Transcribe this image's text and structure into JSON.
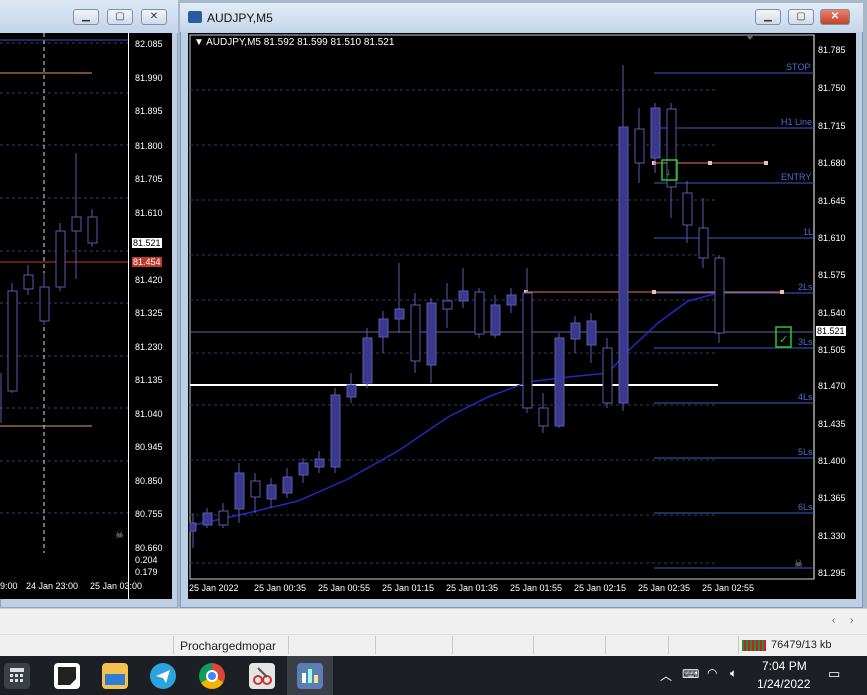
{
  "left_window": {
    "price_labels": [
      "82.085",
      "81.990",
      "81.895",
      "81.800",
      "81.705",
      "81.610",
      "81.521",
      "81.454",
      "81.420",
      "81.325",
      "81.230",
      "81.135",
      "81.040",
      "80.945",
      "80.850",
      "80.755",
      "80.660",
      "0.204",
      "0.179"
    ],
    "time_labels": [
      "9:00",
      "24 Jan 23:00",
      "25 Jan 03:00"
    ]
  },
  "right_window": {
    "title": "AUDJPY,M5",
    "chart_header": "▼ AUDJPY,M5  81.592 81.599 81.510 81.521",
    "price_labels": [
      "81.785",
      "81.750",
      "81.715",
      "81.680",
      "81.645",
      "81.610",
      "81.575",
      "81.540",
      "81.521",
      "81.505",
      "81.470",
      "81.435",
      "81.400",
      "81.365",
      "81.330",
      "81.295"
    ],
    "time_labels": [
      "25 Jan 2022",
      "25 Jan 00:35",
      "25 Jan 00:55",
      "25 Jan 01:15",
      "25 Jan 01:35",
      "25 Jan 01:55",
      "25 Jan 02:15",
      "25 Jan 02:35",
      "25 Jan 02:55"
    ],
    "level_labels": [
      "STOP",
      "H1 Line",
      "ENTRY",
      "1L",
      "2Ls",
      "3Ls",
      "4Ls",
      "5Ls",
      "6Ls"
    ]
  },
  "status_bar": {
    "profile": "Prochargedmopar",
    "traffic": "76479/13 kb"
  },
  "taskbar": {
    "time": "7:04 PM",
    "date": "1/24/2022",
    "icons": [
      "calculator-icon",
      "sticky-notes-icon",
      "file-explorer-icon",
      "telegram-icon",
      "chrome-icon",
      "snipping-tool-icon",
      "metatrader-icon"
    ]
  },
  "colors": {
    "chart_bg": "#000000",
    "candle": "#3a3a8c",
    "level_line": "#3a5bbf",
    "entry_line": "#e07a5f",
    "ma_line": "#1f2bbf",
    "current_price_bg": "#ffffff"
  }
}
